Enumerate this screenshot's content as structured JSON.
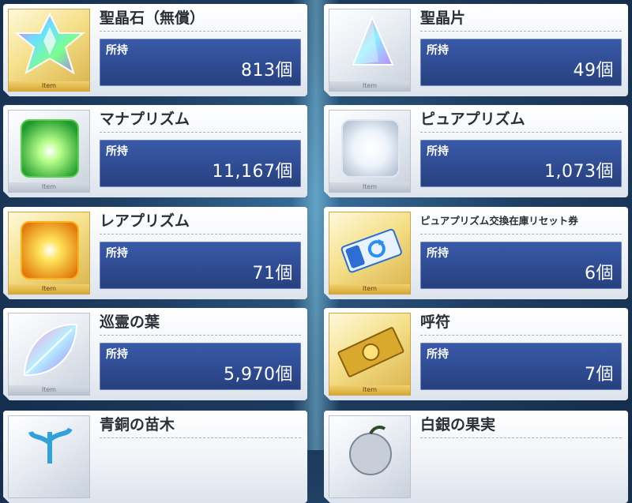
{
  "items": [
    {
      "name": "聖晶石（無償）",
      "hold_label": "所持",
      "count": "813個",
      "tag": "Item",
      "icon": "saint-quartz-star-icon"
    },
    {
      "name": "聖晶片",
      "hold_label": "所持",
      "count": "49個",
      "tag": "Item",
      "icon": "quartz-fragment-pyramid-icon"
    },
    {
      "name": "マナプリズム",
      "hold_label": "所持",
      "count": "11,167個",
      "tag": "Item",
      "icon": "mana-prism-cube-icon"
    },
    {
      "name": "ピュアプリズム",
      "hold_label": "所持",
      "count": "1,073個",
      "tag": "Item",
      "icon": "pure-prism-cube-icon"
    },
    {
      "name": "レアプリズム",
      "hold_label": "所持",
      "count": "71個",
      "tag": "Item",
      "icon": "rare-prism-cube-icon"
    },
    {
      "name": "ピュアプリズム交換在庫リセット券",
      "hold_label": "所持",
      "count": "6個",
      "tag": "Item",
      "icon": "reset-ticket-icon"
    },
    {
      "name": "巡霊の葉",
      "hold_label": "所持",
      "count": "5,970個",
      "tag": "Item",
      "icon": "spirit-leaf-icon"
    },
    {
      "name": "呼符",
      "hold_label": "所持",
      "count": "7個",
      "tag": "Item",
      "icon": "summon-ticket-icon"
    },
    {
      "name": "青銅の苗木",
      "hold_label": "",
      "count": "",
      "tag": "",
      "icon": "bronze-sapling-icon"
    },
    {
      "name": "白銀の果実",
      "hold_label": "",
      "count": "",
      "tag": "",
      "icon": "silver-fruit-icon"
    }
  ],
  "colors": {
    "accent_blue": "#2f4c93",
    "gold_frame": "#d9b24a"
  }
}
